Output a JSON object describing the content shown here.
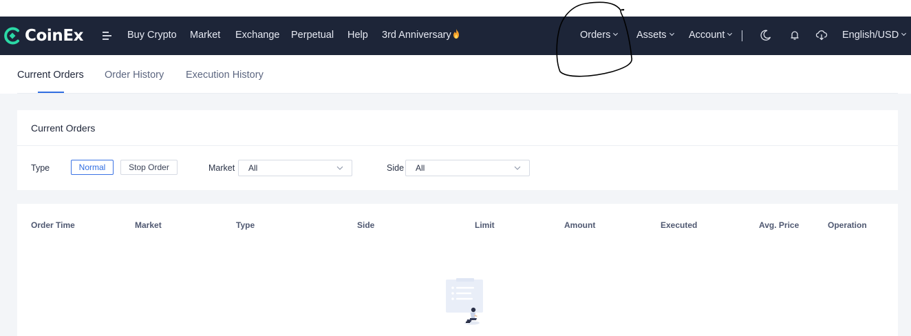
{
  "brand": {
    "name": "CoinEx"
  },
  "header": {
    "nav": [
      {
        "label": "Buy Crypto"
      },
      {
        "label": "Market"
      },
      {
        "label": "Exchange"
      },
      {
        "label": "Perpetual"
      },
      {
        "label": "Help"
      },
      {
        "label": "3rd Anniversary"
      }
    ],
    "right": {
      "orders": "Orders",
      "assets": "Assets",
      "account": "Account",
      "language": "English/USD"
    }
  },
  "tabs": [
    {
      "label": "Current Orders",
      "active": true
    },
    {
      "label": "Order History",
      "active": false
    },
    {
      "label": "Execution History",
      "active": false
    }
  ],
  "filters": {
    "title": "Current Orders",
    "type_label": "Type",
    "type_buttons": [
      "Normal",
      "Stop Order"
    ],
    "market_label": "Market",
    "market_value": "All",
    "side_label": "Side",
    "side_value": "All"
  },
  "table": {
    "columns": [
      "Order Time",
      "Market",
      "Type",
      "Side",
      "Limit",
      "Amount",
      "Executed",
      "Avg. Price",
      "Operation"
    ]
  },
  "colors": {
    "header_bg": "#1d2538",
    "accent": "#2f6de1",
    "page_bg": "#f3f5f8",
    "brand_green": "#2bd9a6"
  },
  "icons": [
    "menu-icon",
    "fire-icon",
    "chevron-down-icon",
    "moon-icon",
    "bell-icon",
    "cloud-download-icon",
    "empty-orders-illustration"
  ]
}
